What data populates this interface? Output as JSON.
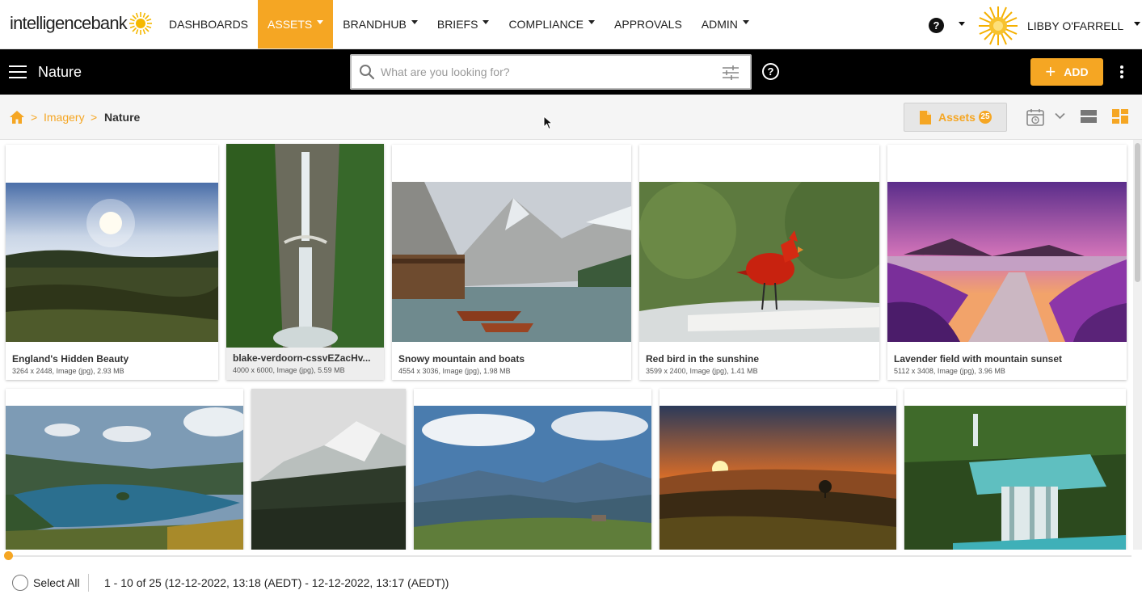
{
  "brand": {
    "name": "intelligencebank",
    "accent": "#f5a623"
  },
  "nav": {
    "items": [
      {
        "label": "DASHBOARDS",
        "dropdown": false,
        "active": false
      },
      {
        "label": "ASSETS",
        "dropdown": true,
        "active": true
      },
      {
        "label": "BRANDHUB",
        "dropdown": true,
        "active": false
      },
      {
        "label": "BRIEFS",
        "dropdown": true,
        "active": false
      },
      {
        "label": "COMPLIANCE",
        "dropdown": true,
        "active": false
      },
      {
        "label": "APPROVALS",
        "dropdown": false,
        "active": false
      },
      {
        "label": "ADMIN",
        "dropdown": true,
        "active": false
      }
    ],
    "help_icon": "question-circle-icon",
    "user_name": "LIBBY O'FARRELL"
  },
  "toolbar": {
    "title": "Nature",
    "search_placeholder": "What are you looking for?",
    "add_label": "ADD"
  },
  "breadcrumb": {
    "items": [
      "Imagery",
      "Nature"
    ],
    "separator": ">"
  },
  "assets_button": {
    "label": "Assets",
    "count": "25"
  },
  "assets": [
    {
      "title": "England's Hidden Beauty",
      "meta": "3264 x 2448, Image (jpg), 2.93 MB"
    },
    {
      "title": "blake-verdoorn-cssvEZacHv...",
      "meta": "4000 x 6000, Image (jpg), 5.59 MB"
    },
    {
      "title": "Snowy mountain and boats",
      "meta": "4554 x 3036, Image (jpg), 1.98 MB"
    },
    {
      "title": "Red bird in the sunshine",
      "meta": "3599 x 2400, Image (jpg), 1.41 MB"
    },
    {
      "title": "Lavender field with mountain sunset",
      "meta": "5112 x 3408, Image (jpg), 3.96 MB"
    },
    {
      "title": "",
      "meta": ""
    },
    {
      "title": "",
      "meta": ""
    },
    {
      "title": "",
      "meta": ""
    },
    {
      "title": "",
      "meta": ""
    },
    {
      "title": "",
      "meta": ""
    }
  ],
  "footer": {
    "select_all": "Select All",
    "range": "1 - 10 of 25 (12-12-2022, 13:18 (AEDT) - 12-12-2022, 13:17 (AEDT))"
  }
}
